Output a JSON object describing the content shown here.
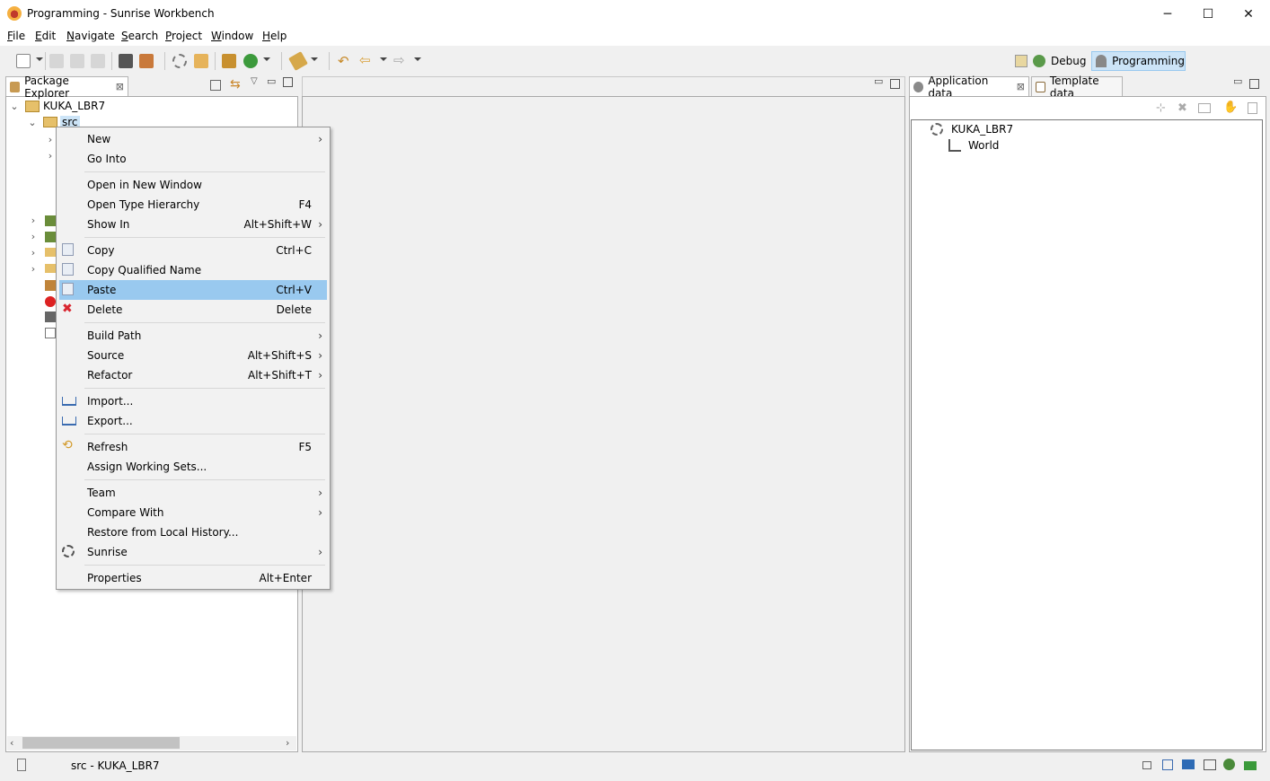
{
  "window": {
    "title": "Programming - Sunrise Workbench",
    "controls": [
      "─",
      "☐",
      "✕"
    ]
  },
  "menubar": {
    "items": [
      {
        "underline": "F",
        "rest": "ile"
      },
      {
        "underline": "E",
        "rest": "dit"
      },
      {
        "underline": "N",
        "rest": "avigate"
      },
      {
        "underline": "S",
        "rest": "earch"
      },
      {
        "underline": "P",
        "rest": "roject"
      },
      {
        "underline": "W",
        "rest": "indow"
      },
      {
        "underline": "H",
        "rest": "elp"
      }
    ]
  },
  "perspectives": {
    "debug": "Debug",
    "programming": "Programming"
  },
  "package_explorer": {
    "tab": "Package Explorer",
    "tree": {
      "project": "KUKA_LBR7",
      "src": "src"
    }
  },
  "right_panel": {
    "tabs": [
      "Application data",
      "Template data"
    ],
    "tree": {
      "root": "KUKA_LBR7",
      "child": "World"
    }
  },
  "context_menu": {
    "items": [
      {
        "label": "New",
        "shortcut": "",
        "submenu": true,
        "icon": ""
      },
      {
        "label": "Go Into",
        "shortcut": "",
        "submenu": false,
        "icon": ""
      },
      {
        "sep": true
      },
      {
        "label": "Open in New Window",
        "shortcut": "",
        "submenu": false,
        "icon": ""
      },
      {
        "label": "Open Type Hierarchy",
        "shortcut": "F4",
        "submenu": false,
        "icon": ""
      },
      {
        "label": "Show In",
        "shortcut": "Alt+Shift+W",
        "submenu": true,
        "icon": ""
      },
      {
        "sep": true
      },
      {
        "label": "Copy",
        "shortcut": "Ctrl+C",
        "submenu": false,
        "icon": "copy-icon"
      },
      {
        "label": "Copy Qualified Name",
        "shortcut": "",
        "submenu": false,
        "icon": "copy-qualified-icon"
      },
      {
        "label": "Paste",
        "shortcut": "Ctrl+V",
        "submenu": false,
        "icon": "paste-icon",
        "highlight": true
      },
      {
        "label": "Delete",
        "shortcut": "Delete",
        "submenu": false,
        "icon": "delete-icon"
      },
      {
        "sep": true
      },
      {
        "label": "Build Path",
        "shortcut": "",
        "submenu": true,
        "icon": ""
      },
      {
        "label": "Source",
        "shortcut": "Alt+Shift+S",
        "submenu": true,
        "icon": ""
      },
      {
        "label": "Refactor",
        "shortcut": "Alt+Shift+T",
        "submenu": true,
        "icon": ""
      },
      {
        "sep": true
      },
      {
        "label": "Import...",
        "shortcut": "",
        "submenu": false,
        "icon": "import-icon"
      },
      {
        "label": "Export...",
        "shortcut": "",
        "submenu": false,
        "icon": "export-icon"
      },
      {
        "sep": true
      },
      {
        "label": "Refresh",
        "shortcut": "F5",
        "submenu": false,
        "icon": "refresh-icon"
      },
      {
        "label": "Assign Working Sets...",
        "shortcut": "",
        "submenu": false,
        "icon": ""
      },
      {
        "sep": true
      },
      {
        "label": "Team",
        "shortcut": "",
        "submenu": true,
        "icon": ""
      },
      {
        "label": "Compare With",
        "shortcut": "",
        "submenu": true,
        "icon": ""
      },
      {
        "label": "Restore from Local History...",
        "shortcut": "",
        "submenu": false,
        "icon": ""
      },
      {
        "label": "Sunrise",
        "shortcut": "",
        "submenu": true,
        "icon": "sunrise-icon"
      },
      {
        "sep": true
      },
      {
        "label": "Properties",
        "shortcut": "Alt+Enter",
        "submenu": false,
        "icon": ""
      }
    ]
  },
  "status": {
    "text": "src - KUKA_LBR7"
  },
  "colors": {
    "highlight": "#99c9ef",
    "perspective_active": "#cce4f7",
    "delete_red": "#d9252f"
  }
}
